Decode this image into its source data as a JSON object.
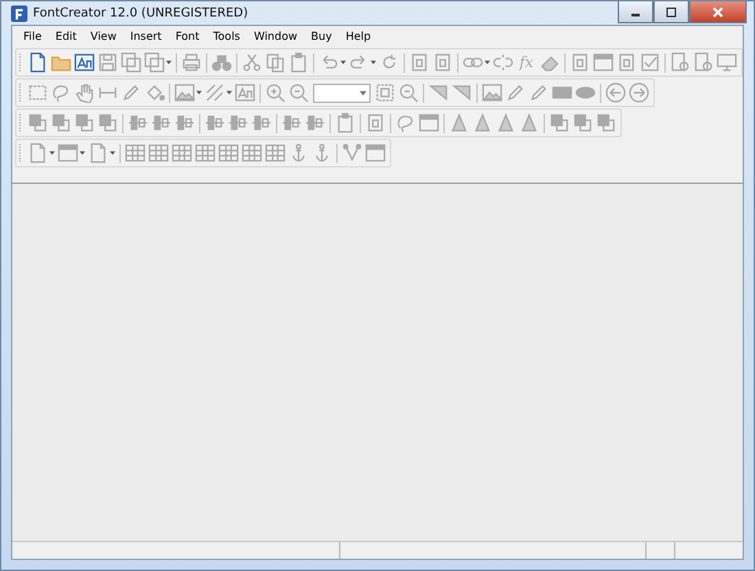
{
  "window": {
    "title": "FontCreator 12.0 (UNREGISTERED)"
  },
  "menu": [
    "File",
    "Edit",
    "View",
    "Insert",
    "Font",
    "Tools",
    "Window",
    "Buy",
    "Help"
  ],
  "toolbars": [
    {
      "groups": [
        [
          {
            "kind": "new",
            "disabled": false
          },
          {
            "kind": "open",
            "disabled": false
          },
          {
            "kind": "font",
            "disabled": false
          },
          {
            "kind": "save",
            "disabled": true
          },
          {
            "kind": "saveall",
            "disabled": true
          },
          {
            "kind": "saveall",
            "disabled": true,
            "dropdown": true
          }
        ],
        [
          {
            "kind": "print",
            "disabled": true
          }
        ],
        [
          {
            "kind": "binoculars",
            "disabled": true
          }
        ],
        [
          {
            "kind": "cut",
            "disabled": true
          },
          {
            "kind": "copy",
            "disabled": true
          },
          {
            "kind": "paste",
            "disabled": true
          }
        ],
        [
          {
            "kind": "undo",
            "disabled": true,
            "dropdown": true
          },
          {
            "kind": "redo",
            "disabled": true,
            "dropdown": true
          },
          {
            "kind": "refresh",
            "disabled": true
          }
        ],
        [
          {
            "kind": "letterdoc",
            "disabled": true
          },
          {
            "kind": "letterdoc",
            "disabled": true
          }
        ],
        [
          {
            "kind": "link",
            "disabled": true,
            "dropdown": true
          },
          {
            "kind": "unlink",
            "disabled": true
          },
          {
            "kind": "text",
            "label": "fx",
            "disabled": true
          },
          {
            "kind": "eraser",
            "disabled": true
          }
        ],
        [
          {
            "kind": "letterdoc",
            "disabled": true
          },
          {
            "kind": "window",
            "disabled": true
          },
          {
            "kind": "letterdoc",
            "disabled": true
          },
          {
            "kind": "checkbox",
            "disabled": true
          }
        ],
        [
          {
            "kind": "preview",
            "disabled": true
          },
          {
            "kind": "preview",
            "disabled": true
          },
          {
            "kind": "monitor",
            "disabled": true
          }
        ]
      ]
    },
    {
      "groups": [
        [
          {
            "kind": "select",
            "disabled": true
          },
          {
            "kind": "lasso",
            "disabled": true
          },
          {
            "kind": "hand",
            "disabled": true
          },
          {
            "kind": "measure",
            "disabled": true
          },
          {
            "kind": "pencil",
            "disabled": true
          },
          {
            "kind": "fill",
            "disabled": true
          }
        ],
        [
          {
            "kind": "image",
            "disabled": true,
            "dropdown": true
          },
          {
            "kind": "hatch",
            "disabled": true,
            "dropdown": true
          },
          {
            "kind": "font",
            "disabled": true
          }
        ],
        [
          {
            "kind": "zoomin",
            "disabled": true
          },
          {
            "kind": "zoomout",
            "disabled": true
          },
          {
            "kind": "combo",
            "disabled": false
          },
          {
            "kind": "fit",
            "disabled": true
          },
          {
            "kind": "zoomout",
            "disabled": true
          }
        ],
        [
          {
            "kind": "triangle",
            "disabled": true
          },
          {
            "kind": "triangle",
            "disabled": true
          }
        ],
        [
          {
            "kind": "image",
            "disabled": true
          },
          {
            "kind": "pencil",
            "disabled": true
          },
          {
            "kind": "pencil",
            "disabled": true
          },
          {
            "kind": "rectfill",
            "disabled": true
          },
          {
            "kind": "ellipse",
            "disabled": true
          }
        ],
        [
          {
            "kind": "left",
            "disabled": true
          },
          {
            "kind": "right",
            "disabled": true
          }
        ]
      ]
    },
    {
      "groups": [
        [
          {
            "kind": "squares",
            "disabled": true
          },
          {
            "kind": "squares",
            "disabled": true
          },
          {
            "kind": "squares",
            "disabled": true
          },
          {
            "kind": "squares",
            "disabled": true
          }
        ],
        [
          {
            "kind": "align",
            "disabled": true
          },
          {
            "kind": "align",
            "disabled": true
          },
          {
            "kind": "align",
            "disabled": true
          }
        ],
        [
          {
            "kind": "align",
            "disabled": true
          },
          {
            "kind": "align",
            "disabled": true
          },
          {
            "kind": "align",
            "disabled": true
          }
        ],
        [
          {
            "kind": "align",
            "disabled": true
          },
          {
            "kind": "align",
            "disabled": true
          }
        ],
        [
          {
            "kind": "paste",
            "disabled": true
          }
        ],
        [
          {
            "kind": "letterdoc",
            "disabled": true
          }
        ],
        [
          {
            "kind": "lasso",
            "disabled": true
          },
          {
            "kind": "window",
            "disabled": true
          }
        ],
        [
          {
            "kind": "wedge",
            "disabled": true
          },
          {
            "kind": "wedge",
            "disabled": true
          },
          {
            "kind": "wedge",
            "disabled": true
          },
          {
            "kind": "wedge",
            "disabled": true
          }
        ],
        [
          {
            "kind": "squares",
            "disabled": true
          },
          {
            "kind": "squares",
            "disabled": true
          },
          {
            "kind": "squares",
            "disabled": true
          }
        ]
      ]
    },
    {
      "groups": [
        [
          {
            "kind": "new",
            "disabled": true,
            "dropdown": true
          },
          {
            "kind": "window",
            "disabled": true,
            "dropdown": true
          },
          {
            "kind": "new",
            "disabled": true,
            "dropdown": true
          }
        ],
        [
          {
            "kind": "grid",
            "disabled": true
          },
          {
            "kind": "grid",
            "disabled": true
          },
          {
            "kind": "grid",
            "disabled": true
          },
          {
            "kind": "grid",
            "disabled": true
          },
          {
            "kind": "grid",
            "disabled": true
          },
          {
            "kind": "grid",
            "disabled": true
          },
          {
            "kind": "grid",
            "disabled": true
          },
          {
            "kind": "anchor",
            "disabled": true
          },
          {
            "kind": "anchor",
            "disabled": true
          }
        ],
        [
          {
            "kind": "node",
            "disabled": true
          },
          {
            "kind": "window",
            "disabled": true
          }
        ]
      ]
    }
  ]
}
